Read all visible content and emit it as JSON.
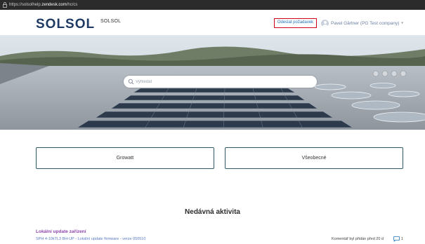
{
  "browser": {
    "url_prefix": "https://solsolhelp.",
    "url_domain": "zendesk.com",
    "url_suffix": "/hc/cs"
  },
  "header": {
    "logo_text": "SOLSOL",
    "brand_name": "SOLSOL",
    "submit_request_label": "Odeslat požadavek",
    "user_name": "Pavel Gärtner (PG Test company)",
    "user_caret": "▾",
    "accent_color": "#1f3b64",
    "highlight_color": "#d0021b"
  },
  "search": {
    "placeholder": "Vyhledat",
    "icon": "search-icon"
  },
  "categories": [
    {
      "label": "Growatt"
    },
    {
      "label": "Všeobecné"
    }
  ],
  "recent_activity": {
    "title": "Nedávná aktivita",
    "items": [
      {
        "title": "Lokální update zařízení",
        "subtitle": "SPH 4-10kTL3 BH-UP - Lokální update firmware - verze 050510",
        "meta": "Komentář byl přidán před 20 d",
        "comment_count": "1",
        "title_color": "#8e44ad"
      }
    ]
  }
}
